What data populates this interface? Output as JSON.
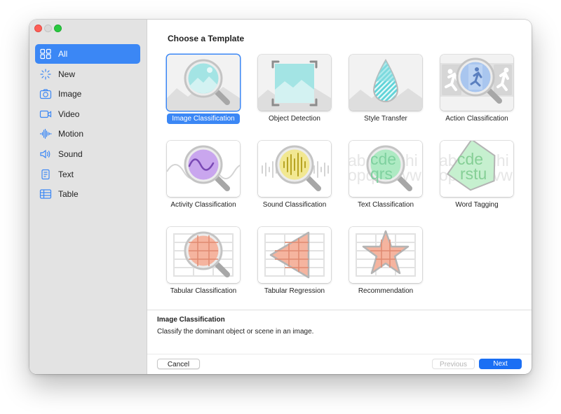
{
  "window": {
    "controls": [
      "close",
      "minimize",
      "zoom"
    ]
  },
  "sidebar": {
    "items": [
      {
        "label": "All",
        "icon": "grid-icon",
        "selected": true
      },
      {
        "label": "New",
        "icon": "sparkle-icon"
      },
      {
        "label": "Image",
        "icon": "camera-icon"
      },
      {
        "label": "Video",
        "icon": "video-icon"
      },
      {
        "label": "Motion",
        "icon": "waveform-icon"
      },
      {
        "label": "Sound",
        "icon": "speaker-icon"
      },
      {
        "label": "Text",
        "icon": "document-icon"
      },
      {
        "label": "Table",
        "icon": "table-icon"
      }
    ]
  },
  "main": {
    "heading": "Choose a Template",
    "templates": [
      {
        "label": "Image Classification",
        "icon": "image-magnifier-icon",
        "selected": true
      },
      {
        "label": "Object Detection",
        "icon": "image-frame-icon"
      },
      {
        "label": "Style Transfer",
        "icon": "droplet-icon"
      },
      {
        "label": "Action Classification",
        "icon": "running-figure-icon"
      },
      {
        "label": "Activity Classification",
        "icon": "sine-wave-magnifier-icon"
      },
      {
        "label": "Sound Classification",
        "icon": "audio-magnifier-icon"
      },
      {
        "label": "Text Classification",
        "icon": "text-magnifier-icon"
      },
      {
        "label": "Word Tagging",
        "icon": "tag-icon"
      },
      {
        "label": "Tabular Classification",
        "icon": "table-magnifier-icon"
      },
      {
        "label": "Tabular Regression",
        "icon": "table-triangle-icon"
      },
      {
        "label": "Recommendation",
        "icon": "table-star-icon"
      }
    ],
    "thumb_text": {
      "top": "abcdefghi",
      "bottom": "opqrstuvw"
    }
  },
  "description": {
    "title": "Image Classification",
    "text": "Classify the dominant object or scene in an image."
  },
  "footer": {
    "cancel": "Cancel",
    "previous": "Previous",
    "next": "Next"
  },
  "colors": {
    "accent": "#3b87f5",
    "next_button": "#1b6ff4",
    "sidebar_bg": "#e3e3e3"
  }
}
